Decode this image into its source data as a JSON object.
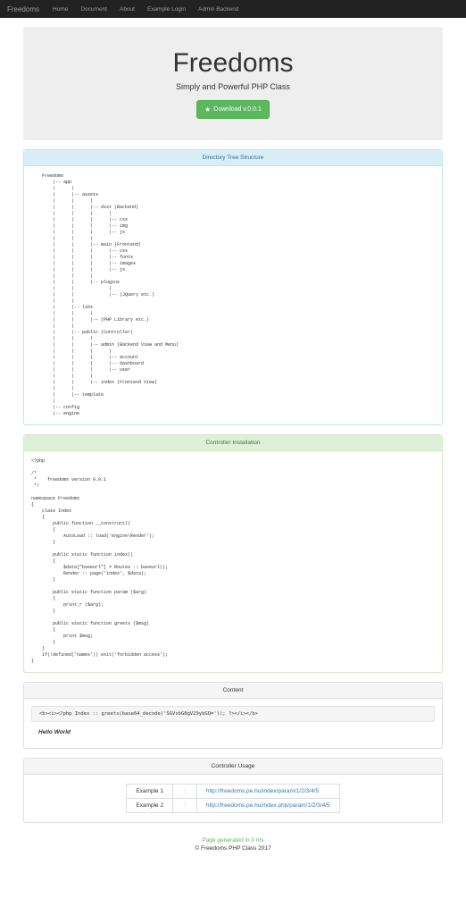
{
  "navbar": {
    "brand": "Freedoms",
    "links": [
      "Home",
      "Document",
      "About",
      "Example Login",
      "Admin Backend"
    ]
  },
  "hero": {
    "title": "Freedoms",
    "subtitle": "Simply and Powerful PHP Class",
    "download_label": "Download v.0.0.1"
  },
  "panels": {
    "tree_heading": "Directory Tree Structure",
    "tree_content": "    Freedoms\n        |-- app\n        |      |\n        |      |-- assets\n        |      |      |\n        |      |      |-- dist (Backend)\n        |      |      |      |\n        |      |      |      |-- css\n        |      |      |      |-- img\n        |      |      |      |-- js\n        |      |      |\n        |      |      |-- main (Frontend)\n        |      |      |      |-- css\n        |      |      |      |-- fonts\n        |      |      |      |-- images\n        |      |      |      |-- js\n        |      |      |\n        |      |      |-- plugins\n        |      |             |\n        |      |             |-- (JQuery etc.)\n        |      |\n        |      |-- libs\n        |      |      |\n        |      |      |-- (PHP Library etc.)\n        |      |\n        |      |-- public (Controller)\n        |      |      |\n        |      |      |-- admin (Backend View and Menu)\n        |      |      |      |\n        |      |      |      |-- account\n        |      |      |      |-- dashboard\n        |      |      |      |-- user\n        |      |      |\n        |      |      |-- index (Frontend View)\n        |      |\n        |      |-- template\n        |\n        |-- config\n        |-- engine",
    "install_heading": "Controller Installation",
    "install_content": "<?php\n\n/*\n *    freedoms version 0.0.1\n */\n\nnamespace Freedoms\n{\n    class Index\n    {\n        public function __construct()\n        {\n            AutoLoad :: load('engine\\Render');\n        }\n\n        public static function index()\n        {\n            $data[\"baseurl\"] = Routes :: baseurl();\n            Render :: page('index', $data);\n        }\n\n        public static function param ($arg)\n        {\n            print_r ($arg);\n        }\n\n        public static function greets ($msg)\n        {\n            print $msg;\n        }\n    }\n    if(!defined('names')) exit('forbidden access');\n}",
    "content_heading": "Content",
    "content_code": "<b><i><?php Index :: greets(base64_decode('SGVsbG8gV29ybGQ=')); ?></i></b>",
    "content_output": "Hello World",
    "usage_heading": "Controller Usage",
    "usage_rows": [
      {
        "label": "Example 1",
        "url": "http://freedoms.pe.hu/index/param/1/2/3/4/5"
      },
      {
        "label": "Example 2",
        "url": "http://freedoms.pe.hu/index.php/param/1/2/3/4/5"
      }
    ]
  },
  "footer": {
    "gen": "Page generated in 0 ms",
    "copy": "© Freedoms PHP Class 2017"
  }
}
